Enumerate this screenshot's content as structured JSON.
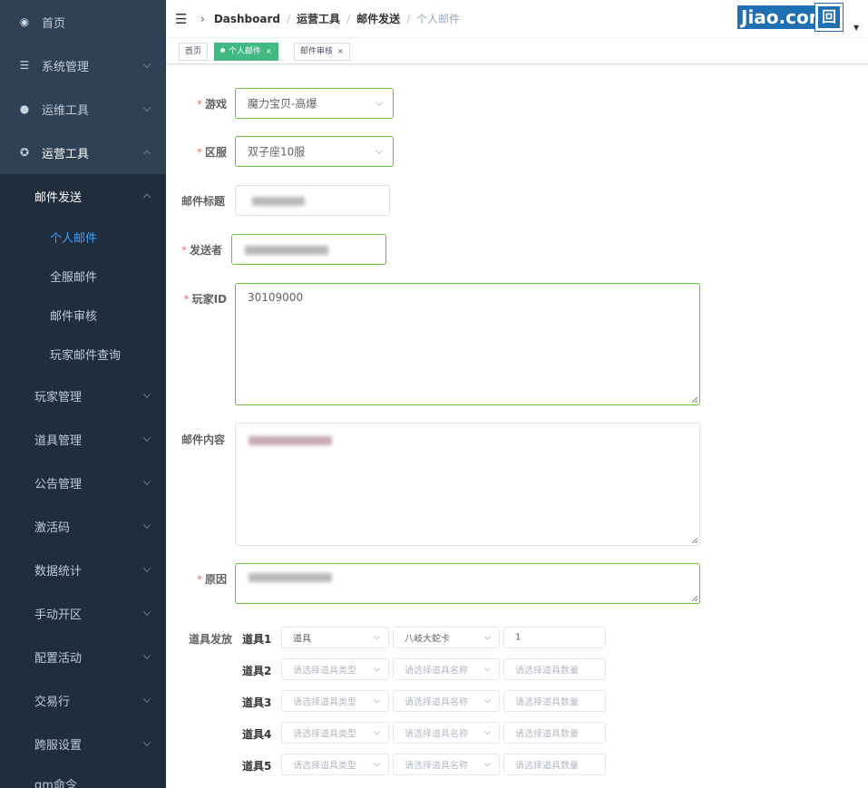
{
  "sidebar": {
    "items": [
      {
        "label": "首页",
        "icon": "dashboard-icon"
      },
      {
        "label": "系统管理",
        "icon": "list-icon"
      },
      {
        "label": "运维工具",
        "icon": "globe-icon"
      },
      {
        "label": "运营工具",
        "icon": "settings-icon"
      }
    ],
    "mail_send": "邮件发送",
    "mail_children": [
      "个人邮件",
      "全服邮件",
      "邮件审核",
      "玩家邮件查询"
    ],
    "groups": [
      "玩家管理",
      "道具管理",
      "公告管理",
      "激活码",
      "数据统计",
      "手动开区",
      "配置活动",
      "交易行",
      "跨服设置",
      "gm命令"
    ]
  },
  "breadcrumb": [
    "Dashboard",
    "运营工具",
    "邮件发送",
    "个人邮件"
  ],
  "header": {
    "logo_text": "Jiao.com",
    "avatar_text": "回"
  },
  "tags": [
    {
      "label": "首页"
    },
    {
      "label": "个人邮件"
    },
    {
      "label": "邮件审核"
    }
  ],
  "form": {
    "game_label": "游戏",
    "game_value": "魔力宝贝-高爆",
    "server_label": "区服",
    "server_value": "双子座10服",
    "title_label": "邮件标题",
    "sender_label": "发送者",
    "player_label": "玩家ID",
    "player_value": "30109000",
    "content_label": "邮件内容",
    "reason_label": "原因",
    "items_label": "道具发放"
  },
  "items": [
    {
      "label": "道具1",
      "type": "道具",
      "name": "八岐大蛇卡",
      "count": "1"
    },
    {
      "label": "道具2",
      "type": "",
      "name": "",
      "count": ""
    },
    {
      "label": "道具3",
      "type": "",
      "name": "",
      "count": ""
    },
    {
      "label": "道具4",
      "type": "",
      "name": "",
      "count": ""
    },
    {
      "label": "道具5",
      "type": "",
      "name": "",
      "count": ""
    }
  ],
  "placeholders": {
    "type": "请选择道具类型",
    "name": "请选择道具名称",
    "count": "请选择道具数量"
  },
  "colors": {
    "sidebar_bg": "#304156",
    "submenu_bg": "#1f2d3d",
    "active_link": "#409eff",
    "success": "#42b983",
    "required": "#f56c6c"
  }
}
